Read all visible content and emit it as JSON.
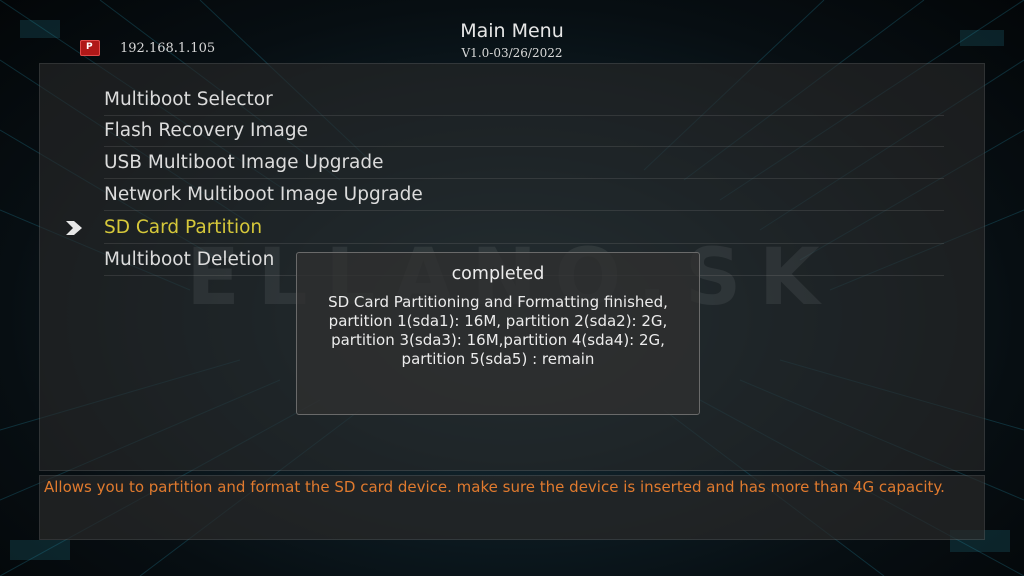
{
  "header": {
    "title": "Main Menu",
    "version": "V1.0-03/26/2022"
  },
  "status": {
    "ip_address": "192.168.1.105",
    "network_icon": "network-icon"
  },
  "menu": {
    "items": [
      {
        "label": "Multiboot Selector",
        "selected": false
      },
      {
        "label": "Flash Recovery Image",
        "selected": false
      },
      {
        "label": "USB Multiboot Image Upgrade",
        "selected": false
      },
      {
        "label": "Network Multiboot Image Upgrade",
        "selected": false
      },
      {
        "label": "SD Card Partition",
        "selected": true
      },
      {
        "label": "Multiboot Deletion",
        "selected": false
      }
    ],
    "selector_icon": "chevron-right-icon"
  },
  "watermark": {
    "text": "ELLANO.SK"
  },
  "dialog": {
    "title": "completed",
    "lines": [
      "SD Card Partitioning and Formatting finished,",
      "partition 1(sda1): 16M, partition 2(sda2): 2G,",
      "partition 3(sda3): 16M,partition 4(sda4): 2G,",
      "partition 5(sda5) : remain"
    ]
  },
  "help": {
    "text": "Allows you to partition and format the SD card device. make sure the device is inserted and has more than 4G capacity."
  },
  "colors": {
    "selected_item": "#d6c83a",
    "help_text": "#e07a2e",
    "normal_text": "#dcdcdc"
  }
}
